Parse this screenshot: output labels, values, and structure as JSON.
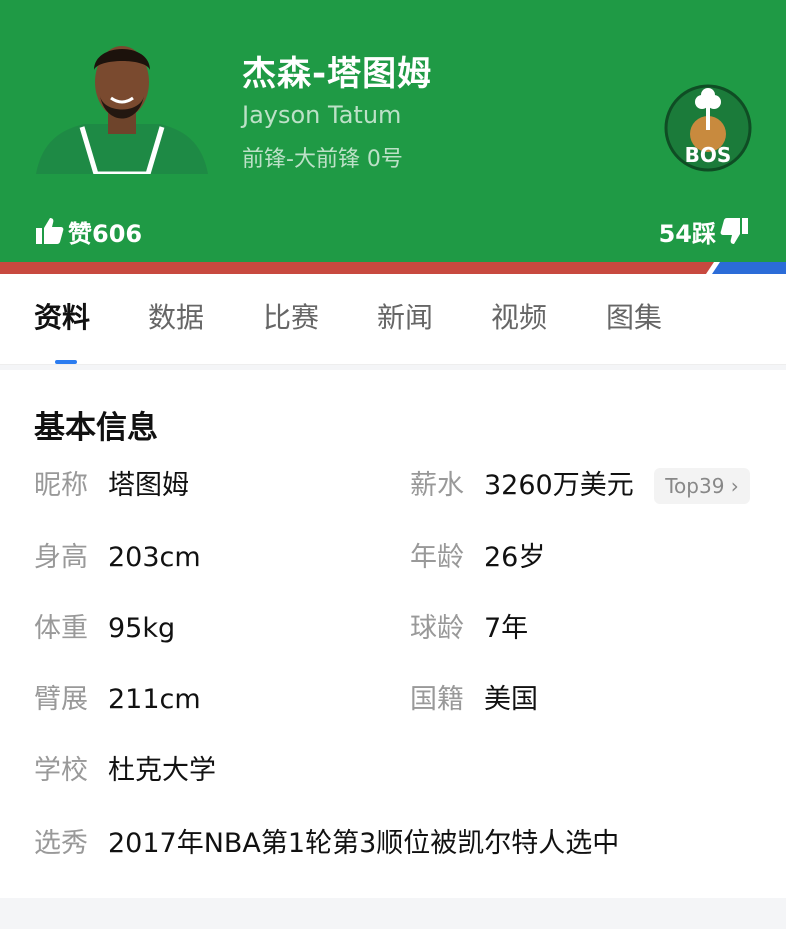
{
  "player": {
    "name_cn": "杰森-塔图姆",
    "name_en": "Jayson Tatum",
    "position_number": "前锋-大前锋  0号",
    "team_abbr": "BOS"
  },
  "votes": {
    "likes": "赞606",
    "dislikes": "54踩"
  },
  "tabs": [
    "资料",
    "数据",
    "比赛",
    "新闻",
    "视频",
    "图集"
  ],
  "active_tab": "资料",
  "section_title": "基本信息",
  "info": {
    "nickname": {
      "label": "昵称",
      "value": "塔图姆"
    },
    "salary": {
      "label": "薪水",
      "value": "3260万美元",
      "rank": "Top39 ›"
    },
    "height": {
      "label": "身高",
      "value": "203cm"
    },
    "age": {
      "label": "年龄",
      "value": "26岁"
    },
    "weight": {
      "label": "体重",
      "value": "95kg"
    },
    "experience": {
      "label": "球龄",
      "value": "7年"
    },
    "wingspan": {
      "label": "臂展",
      "value": "211cm"
    },
    "nationality": {
      "label": "国籍",
      "value": "美国"
    },
    "school": {
      "label": "学校",
      "value": "杜克大学"
    },
    "draft": {
      "label": "选秀",
      "value": "2017年NBA第1轮第3顺位被凯尔特人选中"
    }
  },
  "colors": {
    "header_green": "#1f9a45",
    "bar_red": "#c8493f",
    "bar_blue": "#2b6cd8",
    "tab_indicator": "#2b7cf0"
  },
  "icons": [
    "thumbs-up-icon",
    "thumbs-down-icon",
    "team-logo-icon",
    "player-avatar"
  ]
}
